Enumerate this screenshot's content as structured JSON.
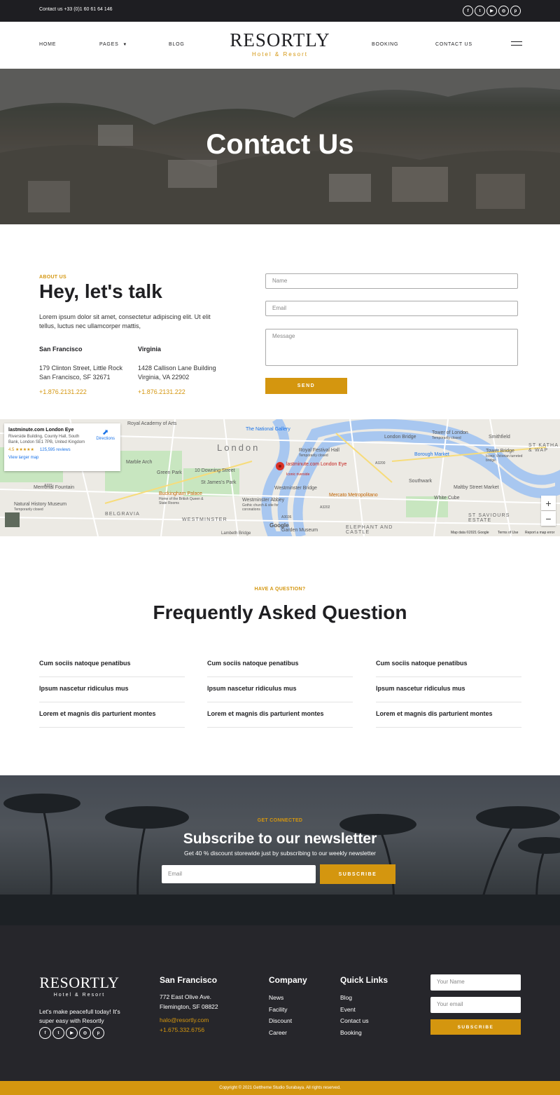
{
  "topbar": {
    "contact": "Contact us +33 (0)1 60 61 64 146",
    "socials": [
      "facebook-icon",
      "twitter-icon",
      "youtube-icon",
      "instagram-icon",
      "pinterest-icon"
    ],
    "social_glyphs": [
      "f",
      "t",
      "▶",
      "◎",
      "p"
    ]
  },
  "nav": {
    "home": "HOME",
    "pages": "PAGES",
    "blog": "BLOG",
    "booking": "BOOKING",
    "contact": "CONTACT US"
  },
  "logo": {
    "brand": "RESORTLY",
    "tagline": "Hotel & Resort"
  },
  "hero": {
    "title": "Contact Us"
  },
  "about": {
    "label": "ABOUT US",
    "title": "Hey, let's talk",
    "intro": "Lorem ipsum dolor sit amet, consectetur adipiscing elit. Ut elit tellus, luctus nec ullamcorper mattis,",
    "offices": [
      {
        "city": "San Francisco",
        "address": "179  Clinton Street, Little Rock\nSan Francisco, SF 32671",
        "phone": "+1.876.2131.222"
      },
      {
        "city": "Virginia",
        "address": "1428 Callison Lane Building\nVirginia, VA 22902",
        "phone": "+1.876.2131.222"
      }
    ]
  },
  "form": {
    "name_placeholder": "Name",
    "email_placeholder": "Email",
    "message_placeholder": "Message",
    "send_label": "SEND"
  },
  "map": {
    "card_title": "lastminute.com London Eye",
    "card_address": "Riverside Building, County Hall, South Bank, London SE1 7PB, United Kingdom",
    "rating": "4.5 ★★★★★",
    "reviews": "125,595 reviews",
    "larger_map": "View larger map",
    "directions": "Directions",
    "labels": {
      "academy": "Royal Academy of Arts",
      "gallery": "The National Gallery",
      "london": "London",
      "festival": "Royal Festival Hall",
      "festival_sub": "Temporarily closed",
      "bridge": "London Bridge",
      "tower": "Tower of London",
      "tower_sub": "Temporarily closed",
      "smithfield": "Smithfield",
      "marble": "Marble Arch",
      "fountain": "Memorial Fountain",
      "green": "Green Park",
      "downing": "10 Downing Street",
      "eye": "lastminute.com London Eye",
      "eye_sub": "Iconic riverside",
      "borough": "Borough Market",
      "towerbridge": "Tower Bridge",
      "towerbridge_sub": "Iconic Victorian turreted bridge",
      "katharine": "ST KATHA & WAP",
      "southwark": "Southwark",
      "stjames": "St James's Park",
      "maltby": "Maltby Street Market",
      "westminster_bridge": "Westminster Bridge",
      "buckingham": "Buckingham Palace",
      "buckingham_sub": "Home of the British Queen & State Rooms",
      "abbey": "Westminster Abbey",
      "abbey_sub": "Gothic church & site for coronations",
      "mercato": "Mercato Metropolitano",
      "whitecube": "White Cube",
      "nhm": "Natural History Museum",
      "nhm_sub": "Temporarily closed",
      "belgravia": "BELGRAVIA",
      "westminster": "WESTMINSTER",
      "saviours": "ST SAVIOURS ESTATE",
      "elephant": "ELEPHANT AND CASTLE",
      "garden": "Garden Museum",
      "lambeth": "Lambeth Bridge",
      "a315": "A315",
      "a3200": "A3200",
      "a3202": "A3202",
      "a3036": "A3036",
      "google": "Google"
    },
    "zoom_in": "+",
    "zoom_out": "−",
    "attribution": "Map data ©2021 Google",
    "terms": "Terms of Use",
    "report": "Report a map error"
  },
  "faq": {
    "label": "HAVE A QUESTION?",
    "title": "Frequently Asked Question",
    "columns": [
      [
        "Cum sociis natoque penatibus",
        "Ipsum nascetur ridiculus mus",
        "Lorem et magnis dis parturient montes"
      ],
      [
        "Cum sociis natoque penatibus",
        "Ipsum nascetur ridiculus mus",
        "Lorem et magnis dis parturient montes"
      ],
      [
        "Cum sociis natoque penatibus",
        "Ipsum nascetur ridiculus mus",
        "Lorem et magnis dis parturient montes"
      ]
    ]
  },
  "newsletter": {
    "label": "GET CONNECTED",
    "title": "Subscribe to our newsletter",
    "subtitle": "Get 40 % discount storewide just by subscribing to our weekly newsletter",
    "email_placeholder": "Email",
    "button": "SUBSCRIBE"
  },
  "footer": {
    "brand": "RESORTLY",
    "tagline": "Hotel & Resort",
    "text": "Let's make peacefull today! It's super easy with Resortly",
    "sf": {
      "title": "San Francisco",
      "address": "772 East Olive Ave.",
      "city": "Flemington, SF 08822",
      "email": "halo@resortly.com",
      "phone": "+1.675.332.6756"
    },
    "company": {
      "title": "Company",
      "links": [
        "News",
        "Facility",
        "Discount",
        "Career"
      ]
    },
    "quick": {
      "title": "Quick Links",
      "links": [
        "Blog",
        "Event",
        "Contact us",
        "Booking"
      ]
    },
    "name_placeholder": "Your Name",
    "email_placeholder": "Your email",
    "button": "SUBSCRIBE"
  },
  "copyright": "Copyright © 2021 Gettheme Studio Surabaya. All rights reserved.",
  "colors": {
    "accent": "#d4960f",
    "dark": "#26262b",
    "topbar": "#1e1e22"
  }
}
